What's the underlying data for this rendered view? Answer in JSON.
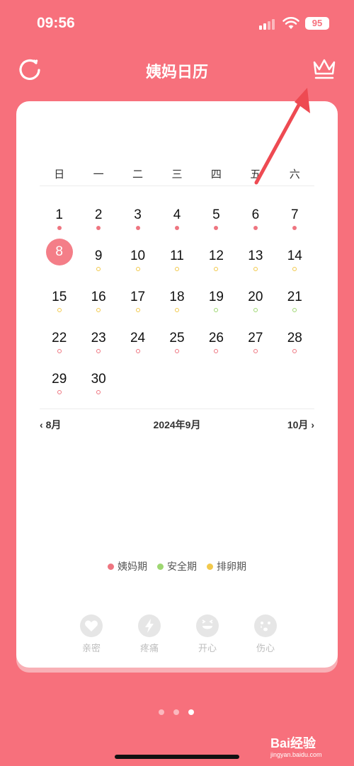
{
  "status_bar": {
    "time": "09:56",
    "battery": "95"
  },
  "header": {
    "title": "姨妈日历"
  },
  "calendar": {
    "weekdays": [
      "日",
      "一",
      "二",
      "三",
      "四",
      "五",
      "六"
    ],
    "today": 8,
    "days": [
      {
        "n": "1",
        "mark": "period-filled"
      },
      {
        "n": "2",
        "mark": "period-filled"
      },
      {
        "n": "3",
        "mark": "period-filled"
      },
      {
        "n": "4",
        "mark": "period-filled"
      },
      {
        "n": "5",
        "mark": "period-filled"
      },
      {
        "n": "6",
        "mark": "period-filled"
      },
      {
        "n": "7",
        "mark": "period-filled"
      },
      {
        "n": "8",
        "mark": "today"
      },
      {
        "n": "9",
        "mark": "ovulation-hollow"
      },
      {
        "n": "10",
        "mark": "ovulation-hollow"
      },
      {
        "n": "11",
        "mark": "ovulation-hollow"
      },
      {
        "n": "12",
        "mark": "ovulation-hollow"
      },
      {
        "n": "13",
        "mark": "ovulation-hollow"
      },
      {
        "n": "14",
        "mark": "ovulation-hollow"
      },
      {
        "n": "15",
        "mark": "ovulation-hollow"
      },
      {
        "n": "16",
        "mark": "ovulation-hollow"
      },
      {
        "n": "17",
        "mark": "ovulation-hollow"
      },
      {
        "n": "18",
        "mark": "ovulation-hollow"
      },
      {
        "n": "19",
        "mark": "safe-hollow"
      },
      {
        "n": "20",
        "mark": "safe-hollow"
      },
      {
        "n": "21",
        "mark": "safe-hollow"
      },
      {
        "n": "22",
        "mark": "period-hollow"
      },
      {
        "n": "23",
        "mark": "period-hollow"
      },
      {
        "n": "24",
        "mark": "period-hollow"
      },
      {
        "n": "25",
        "mark": "period-hollow"
      },
      {
        "n": "26",
        "mark": "period-hollow"
      },
      {
        "n": "27",
        "mark": "period-hollow"
      },
      {
        "n": "28",
        "mark": "period-hollow"
      },
      {
        "n": "29",
        "mark": "period-hollow"
      },
      {
        "n": "30",
        "mark": "period-hollow"
      }
    ],
    "prev_month": "8月",
    "current_month": "2024年9月",
    "next_month": "10月"
  },
  "legend": [
    {
      "label": "姨妈期",
      "color": "#EE7580"
    },
    {
      "label": "安全期",
      "color": "#9ED772"
    },
    {
      "label": "排卵期",
      "color": "#F2C94C"
    }
  ],
  "moods": [
    {
      "label": "亲密",
      "icon": "heart-icon"
    },
    {
      "label": "疼痛",
      "icon": "lightning-icon"
    },
    {
      "label": "开心",
      "icon": "laughing-face-icon"
    },
    {
      "label": "伤心",
      "icon": "crying-face-icon"
    }
  ],
  "pager": {
    "pages": 3,
    "active": 2
  },
  "watermark": {
    "brand": "Bai经验",
    "url": "jingyan.baidu.com"
  },
  "colors": {
    "background": "#F7707C",
    "card": "#FFFFFF",
    "today": "#F47E88"
  }
}
